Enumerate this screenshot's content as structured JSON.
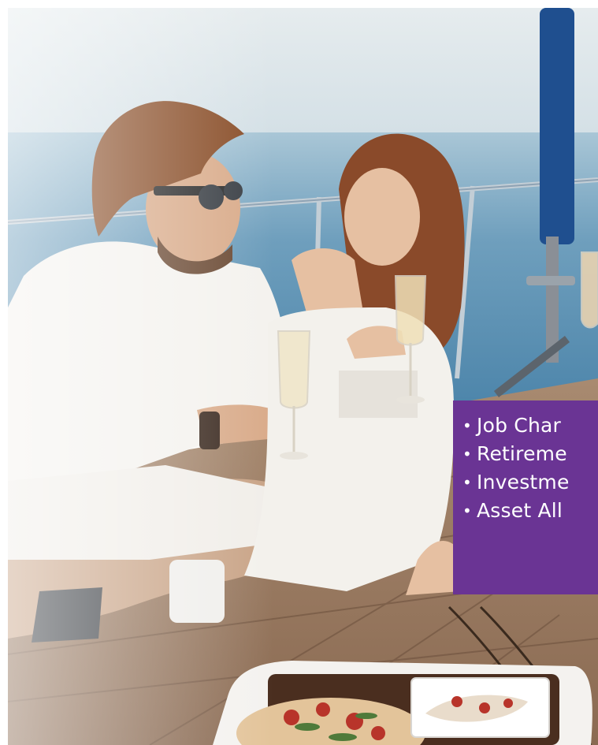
{
  "promo_panel": {
    "color": "#6a3494",
    "items": [
      {
        "label": "Job Char"
      },
      {
        "label": "Retireme"
      },
      {
        "label": "Investme"
      },
      {
        "label": "Asset All"
      }
    ]
  },
  "photo": {
    "subject": "couple toasting with champagne on a sailboat deck",
    "icons": [
      "champagne-glass-icon",
      "sailboat-mast-icon"
    ]
  }
}
